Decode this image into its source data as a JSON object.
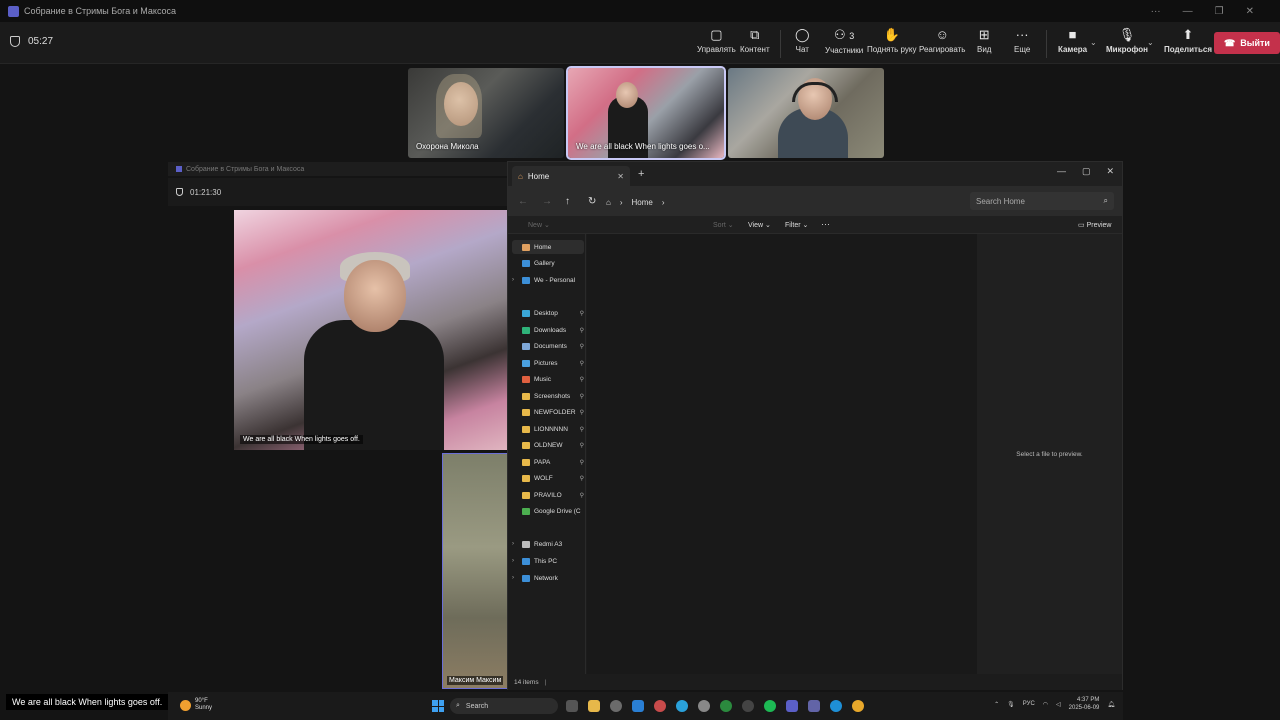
{
  "teams": {
    "window_title": "Собрание в Стримы Бога и Максоса",
    "timer": "05:27",
    "toolbar": [
      {
        "label": "Управлять",
        "icon": "manage-icon"
      },
      {
        "label": "Контент",
        "icon": "share-content-icon"
      },
      {
        "label": "Чат",
        "icon": "chat-icon"
      },
      {
        "label": "Участники",
        "icon": "participants-icon",
        "count": "3"
      },
      {
        "label": "Поднять руку",
        "icon": "raise-hand-icon"
      },
      {
        "label": "Реагировать",
        "icon": "react-icon"
      },
      {
        "label": "Вид",
        "icon": "view-icon"
      },
      {
        "label": "Еще",
        "icon": "more-icon"
      },
      {
        "label": "Камера",
        "icon": "camera-icon"
      },
      {
        "label": "Микрофон",
        "icon": "microphone-icon"
      },
      {
        "label": "Поделиться",
        "icon": "share-icon"
      }
    ],
    "leave_label": "Выйти",
    "tiles": [
      {
        "name": "Охорона Микола"
      },
      {
        "name": "We are all black When lights goes o..."
      },
      {
        "name": ""
      }
    ]
  },
  "inner_meeting": {
    "title": "Собрание в Стримы Бога и Максоса",
    "timer": "01:21:30",
    "big_caption": "We are all black When lights goes off.",
    "small_name": "Максим Максим"
  },
  "explorer": {
    "tab_title": "Home",
    "breadcrumb": "Home",
    "search_placeholder": "Search Home",
    "cmd": {
      "new": "New",
      "sort": "Sort",
      "view": "View",
      "filter": "Filter",
      "more": "···",
      "preview": "Preview"
    },
    "nav": [
      {
        "label": "Home",
        "color": "#e0a060",
        "pin": false,
        "chev": false,
        "selected": true
      },
      {
        "label": "Gallery",
        "color": "#3c8fd8",
        "pin": false,
        "chev": false
      },
      {
        "label": "We - Personal",
        "color": "#3c8fd8",
        "pin": false,
        "chev": true
      },
      {
        "label": "Desktop",
        "color": "#3aa7d8",
        "pin": true,
        "chev": false
      },
      {
        "label": "Downloads",
        "color": "#2fb37a",
        "pin": true,
        "chev": false
      },
      {
        "label": "Documents",
        "color": "#7fa8d8",
        "pin": true,
        "chev": false
      },
      {
        "label": "Pictures",
        "color": "#4aa0e0",
        "pin": true,
        "chev": false
      },
      {
        "label": "Music",
        "color": "#e06040",
        "pin": true,
        "chev": false
      },
      {
        "label": "Screenshots",
        "color": "#e7b84a",
        "pin": true,
        "chev": false
      },
      {
        "label": "NEWFOLDER",
        "color": "#e7b84a",
        "pin": true,
        "chev": false
      },
      {
        "label": "LIONNNNN",
        "color": "#e7b84a",
        "pin": true,
        "chev": false
      },
      {
        "label": "OLDNEW",
        "color": "#e7b84a",
        "pin": true,
        "chev": false
      },
      {
        "label": "PAPA",
        "color": "#e7b84a",
        "pin": true,
        "chev": false
      },
      {
        "label": "WOLF",
        "color": "#e7b84a",
        "pin": true,
        "chev": false
      },
      {
        "label": "PRAVILO",
        "color": "#e7b84a",
        "pin": true,
        "chev": false
      },
      {
        "label": "Google Drive (C",
        "color": "#4caf50",
        "pin": true,
        "chev": false
      },
      {
        "label": "Redmi A3",
        "color": "#bbbbbb",
        "pin": false,
        "chev": true
      },
      {
        "label": "This PC",
        "color": "#3c8fd8",
        "pin": false,
        "chev": true
      },
      {
        "label": "Network",
        "color": "#3c8fd8",
        "pin": false,
        "chev": true
      }
    ],
    "preview_text": "Select a file to preview.",
    "status": "14 items"
  },
  "caption": "We are all black When lights goes off.",
  "taskbar": {
    "weather_temp": "90°F",
    "weather_text": "Sunny",
    "search_label": "Search",
    "lang": "РУС",
    "time": "4:37 PM",
    "date": "2025-06-09"
  },
  "colors": {
    "leave": "#c4314b",
    "accent": "#5b5fc7"
  }
}
